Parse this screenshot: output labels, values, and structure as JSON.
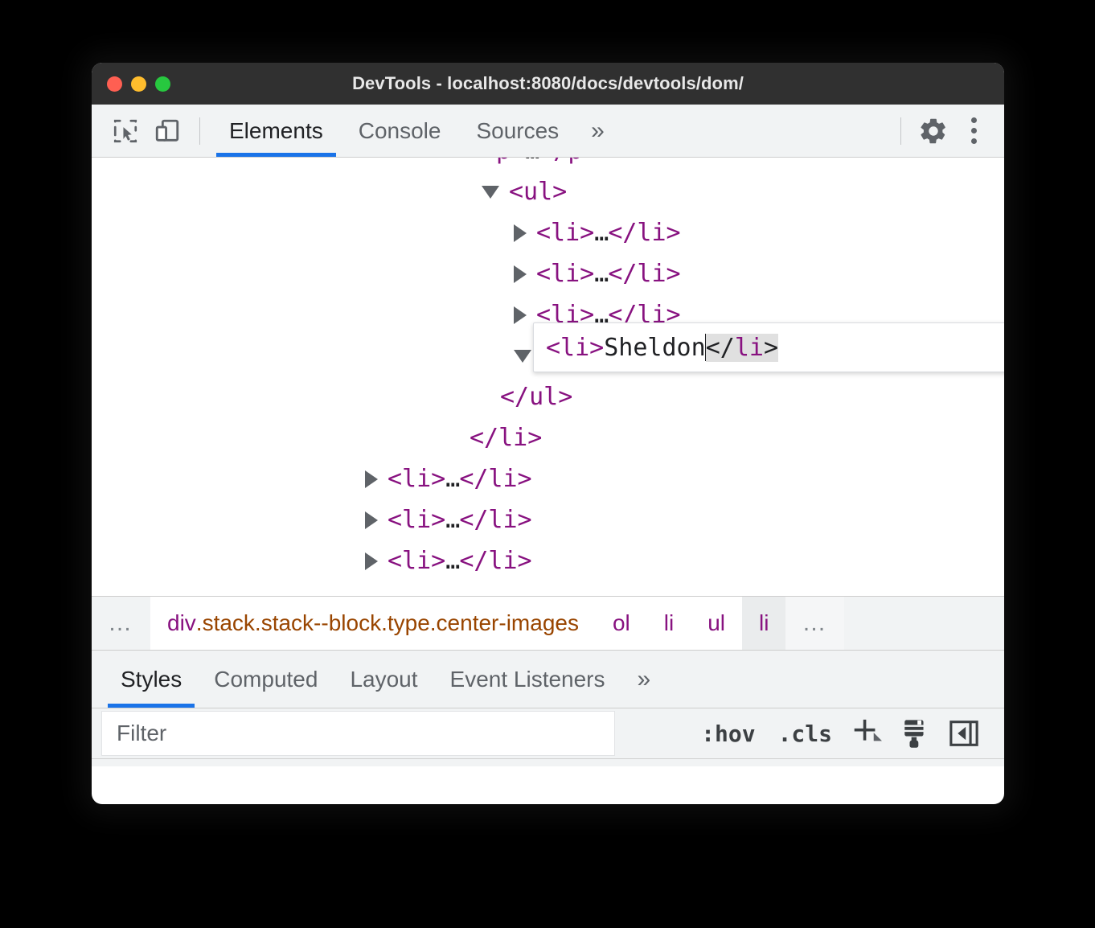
{
  "window": {
    "title": "DevTools - localhost:8080/docs/devtools/dom/",
    "traffic_lights": [
      "close",
      "minimize",
      "maximize"
    ]
  },
  "toolbar": {
    "inspect_icon": "inspect-cursor-icon",
    "device_icon": "device-toolbar-icon",
    "settings_icon": "gear-icon",
    "menu_icon": "kebab-menu-icon",
    "tabs": [
      {
        "label": "Elements",
        "active": true
      },
      {
        "label": "Console",
        "active": false
      },
      {
        "label": "Sources",
        "active": false
      }
    ],
    "more_tabs_label": "»"
  },
  "dom_tree": {
    "rows": [
      {
        "indent": 0,
        "marker": "none",
        "text": "<p>…</p>",
        "clipped": true
      },
      {
        "indent": 0,
        "marker": "open",
        "text": "<ul>"
      },
      {
        "indent": 1,
        "marker": "closed",
        "text": "<li>…</li>"
      },
      {
        "indent": 1,
        "marker": "closed",
        "text": "<li>…</li>"
      },
      {
        "indent": 1,
        "marker": "closed",
        "text": "<li>…</li>"
      },
      {
        "indent": 1,
        "marker": "open",
        "text": "editor"
      },
      {
        "indent": 0,
        "marker": "none",
        "text": "</ul>"
      },
      {
        "indent": -1,
        "marker": "none",
        "text": "</li>"
      },
      {
        "indent": -1,
        "marker": "closed",
        "text": "<li>…</li>"
      },
      {
        "indent": -1,
        "marker": "closed",
        "text": "<li>…</li>"
      },
      {
        "indent": -1,
        "marker": "closed",
        "text": "<li>…</li>"
      }
    ],
    "editor": {
      "open_tag": "<li>",
      "content": "Sheldon",
      "close_tag_selected": "</li>",
      "caret_after": "Sheldon"
    },
    "clipped_top_row": "<p>…</p>"
  },
  "breadcrumb": {
    "overflow_left": "…",
    "items": [
      {
        "tag": "div",
        "classes": ".stack.stack--block.type.center-images",
        "selected": false,
        "white": true
      },
      {
        "tag": "ol",
        "classes": "",
        "selected": false,
        "white": true
      },
      {
        "tag": "li",
        "classes": "",
        "selected": false,
        "white": true
      },
      {
        "tag": "ul",
        "classes": "",
        "selected": false,
        "white": true
      },
      {
        "tag": "li",
        "classes": "",
        "selected": true,
        "white": false
      }
    ],
    "overflow_right": "…"
  },
  "styles_pane": {
    "tabs": [
      {
        "label": "Styles",
        "active": true
      },
      {
        "label": "Computed",
        "active": false
      },
      {
        "label": "Layout",
        "active": false
      },
      {
        "label": "Event Listeners",
        "active": false
      }
    ],
    "more_tabs_label": "»",
    "filter": {
      "value": "",
      "placeholder": "Filter"
    },
    "actions": {
      "hov_label": ":hov",
      "cls_label": ".cls",
      "new_rule_icon": "plus-icon",
      "style_source_icon": "paintbrush-icon",
      "toggle_sidebar_icon": "panel-collapse-icon"
    }
  },
  "colors": {
    "accent": "#1a73e8",
    "tag": "#881280",
    "attr_class": "#994500",
    "text": "#202124",
    "muted": "#5f6368",
    "chrome_bg": "#f1f3f4",
    "titlebar_bg": "#303030"
  }
}
